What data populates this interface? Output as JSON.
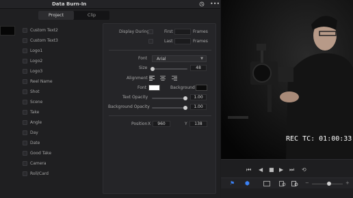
{
  "window": {
    "title": "Data Burn-In",
    "tabs": [
      {
        "label": "Project",
        "active": true
      },
      {
        "label": "Clip",
        "active": false
      }
    ]
  },
  "fields_list": [
    "Custom Text2",
    "Custom Text3",
    "Logo1",
    "Logo2",
    "Logo3",
    "Reel Name",
    "Shot",
    "Scene",
    "Take",
    "Angle",
    "Day",
    "Date",
    "Good Take",
    "Camera",
    "Roll/Card"
  ],
  "settings": {
    "display_during_label": "Display During",
    "first_label": "First",
    "last_label": "Last",
    "frames_label_1": "Frames",
    "frames_label_2": "Frames",
    "font_label": "Font",
    "font_value": "Arial",
    "size_label": "Size",
    "size_value": "48",
    "alignment_label": "Alignment",
    "font_color_label": "Font",
    "font_color": "#ffffff",
    "background_label": "Background",
    "background_color": "#0c0c0c",
    "text_opacity_label": "Text Opacity",
    "text_opacity_value": "1.00",
    "bg_opacity_label": "Background Opacity",
    "bg_opacity_value": "1.00",
    "position_label": "Position",
    "x_label": "X",
    "x_value": "960",
    "y_label": "Y",
    "y_value": "138"
  },
  "viewer": {
    "burn_in_text": "REC TC: 01:00:33"
  },
  "colors": {
    "accent": "#3b82f6"
  }
}
